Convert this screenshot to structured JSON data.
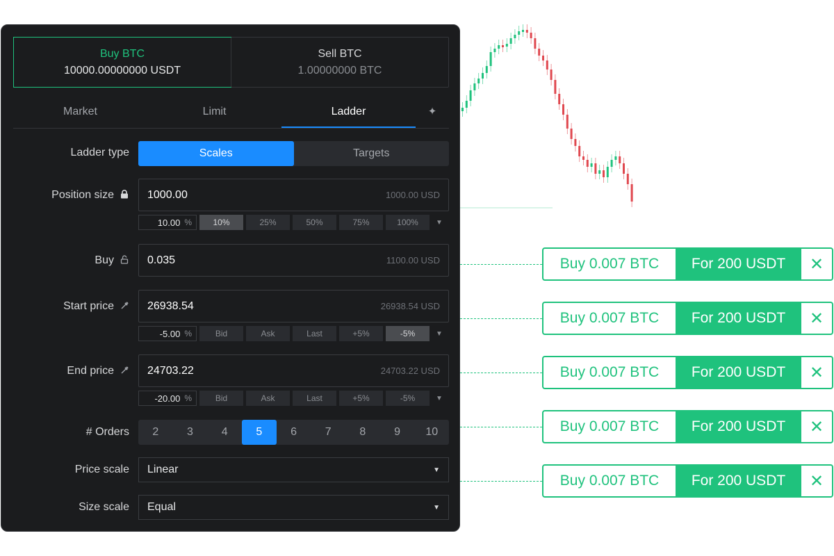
{
  "sides": [
    {
      "label": "Buy BTC",
      "amount": "10000.00000000 USDT"
    },
    {
      "label": "Sell BTC",
      "amount": "1.00000000 BTC"
    }
  ],
  "order_types": [
    "Market",
    "Limit",
    "Ladder"
  ],
  "ladder_type": {
    "label": "Ladder type",
    "options": [
      "Scales",
      "Targets"
    ],
    "selected": "Scales"
  },
  "position_size": {
    "label": "Position size",
    "value": "1000.00",
    "aux": "1000.00 USD",
    "pct": "10.00",
    "pct_unit": "%",
    "quick": [
      "10%",
      "25%",
      "50%",
      "75%",
      "100%"
    ],
    "quick_active": "10%"
  },
  "buy": {
    "label": "Buy",
    "value": "0.035",
    "aux": "1100.00 USD"
  },
  "start_price": {
    "label": "Start price",
    "value": "26938.54",
    "aux": "26938.54 USD",
    "pct": "-5.00",
    "pct_unit": "%",
    "quick": [
      "Bid",
      "Ask",
      "Last",
      "+5%",
      "-5%"
    ],
    "quick_active": "-5%"
  },
  "end_price": {
    "label": "End price",
    "value": "24703.22",
    "aux": "24703.22 USD",
    "pct": "-20.00",
    "pct_unit": "%",
    "quick": [
      "Bid",
      "Ask",
      "Last",
      "+5%",
      "-5%"
    ],
    "quick_active": ""
  },
  "orders": {
    "label": "# Orders",
    "options": [
      "2",
      "3",
      "4",
      "5",
      "6",
      "7",
      "8",
      "9",
      "10"
    ],
    "selected": "5"
  },
  "price_scale": {
    "label": "Price scale",
    "value": "Linear"
  },
  "size_scale": {
    "label": "Size scale",
    "value": "Equal"
  },
  "ladder_orders": [
    {
      "amount": "Buy 0.007 BTC",
      "cost": "For 200 USDT"
    },
    {
      "amount": "Buy 0.007 BTC",
      "cost": "For 200 USDT"
    },
    {
      "amount": "Buy 0.007 BTC",
      "cost": "For 200 USDT"
    },
    {
      "amount": "Buy 0.007 BTC",
      "cost": "For 200 USDT"
    },
    {
      "amount": "Buy 0.007 BTC",
      "cost": "For 200 USDT"
    }
  ],
  "colors": {
    "accent_green": "#1fc27d",
    "accent_blue": "#1a8cff",
    "bear_red": "#e0484f",
    "panel_bg": "#1b1c1e"
  },
  "icons": {
    "lock": "lock-icon",
    "unlock": "unlock-icon",
    "pick": "eyedropper-icon",
    "close": "close-icon",
    "spark": "sparkle-icon",
    "caret": "caret-down-icon"
  }
}
